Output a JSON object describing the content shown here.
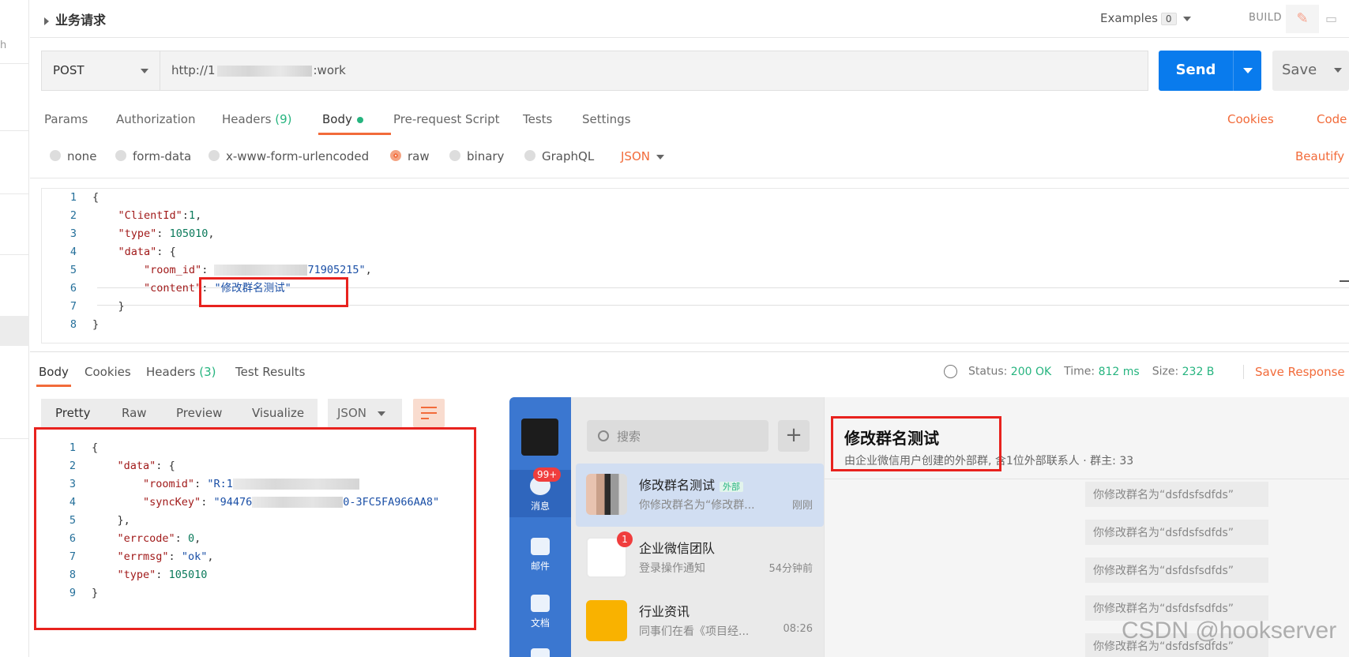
{
  "header": {
    "title": "业务请求",
    "examples_label": "Examples",
    "examples_count": "0",
    "build_label": "BUILD"
  },
  "request": {
    "method": "POST",
    "url_prefix": "http://1",
    "url_suffix": ":work",
    "send_label": "Send",
    "save_label": "Save"
  },
  "request_tabs": {
    "params": "Params",
    "authorization": "Authorization",
    "headers": "Headers",
    "headers_count": "(9)",
    "body": "Body",
    "pre_request": "Pre-request Script",
    "tests": "Tests",
    "settings": "Settings",
    "cookies": "Cookies",
    "code": "Code"
  },
  "body_types": {
    "none": "none",
    "form_data": "form-data",
    "urlencoded": "x-www-form-urlencoded",
    "raw": "raw",
    "binary": "binary",
    "graphql": "GraphQL",
    "json": "JSON",
    "beautify": "Beautify"
  },
  "request_body": {
    "line_numbers": [
      "1",
      "2",
      "3",
      "4",
      "5",
      "6",
      "7",
      "8"
    ],
    "l1": "{",
    "l2_key": "\"ClientId\"",
    "l2_val": "1",
    "l3_key": "\"type\"",
    "l3_val": "105010",
    "l4_key": "\"data\"",
    "l4_open": "{",
    "l5_key": "\"room_id\"",
    "l5_val_tail": "71905215\"",
    "l6_key": "\"content\"",
    "l6_val": "\"修改群名测试\"",
    "l7": "}",
    "l8": "}"
  },
  "response_tabs": {
    "body": "Body",
    "cookies": "Cookies",
    "headers": "Headers",
    "headers_count": "(3)",
    "test_results": "Test Results",
    "status_label": "Status:",
    "status_value": "200 OK",
    "time_label": "Time:",
    "time_value": "812 ms",
    "size_label": "Size:",
    "size_value": "232 B",
    "save_response": "Save Response"
  },
  "view_modes": {
    "pretty": "Pretty",
    "raw": "Raw",
    "preview": "Preview",
    "visualize": "Visualize",
    "format": "JSON"
  },
  "response_body": {
    "line_numbers": [
      "1",
      "2",
      "3",
      "4",
      "5",
      "6",
      "7",
      "8",
      "9"
    ],
    "l1": "{",
    "l2_key": "\"data\"",
    "l2_open": "{",
    "l3_key": "\"roomid\"",
    "l3_val_head": "\"R:1",
    "l4_key": "\"syncKey\"",
    "l4_val_head": "\"94476",
    "l4_val_tail": "0-3FC5FA966AA8\"",
    "l5": "},",
    "l6_key": "\"errcode\"",
    "l6_val": "0",
    "l7_key": "\"errmsg\"",
    "l7_val": "\"ok\"",
    "l8_key": "\"type\"",
    "l8_val": "105010",
    "l9": "}"
  },
  "wecom": {
    "nav": {
      "messages_label": "消息",
      "messages_badge": "99+",
      "mail_label": "邮件",
      "docs_label": "文档"
    },
    "search_placeholder": "搜索",
    "plus": "+",
    "conversations": [
      {
        "name": "修改群名测试",
        "tag": "外部",
        "preview": "你修改群名为“修改群...",
        "time": "刚刚"
      },
      {
        "name": "企业微信团队",
        "badge": "1",
        "preview": "登录操作通知",
        "time": "54分钟前"
      },
      {
        "name": "行业资讯",
        "preview": "同事们在看《项目经...",
        "time": "08:26"
      }
    ],
    "chat": {
      "title": "修改群名测试",
      "subtitle": "由企业微信用户创建的外部群, 含1位外部联系人 · 群主: 33",
      "system_messages": [
        "你修改群名为“dsfdsfsdfds”",
        "你修改群名为“dsfdsfsdfds”",
        "你修改群名为“dsfdsfsdfds”",
        "你修改群名为“dsfdsfsdfds”",
        "你修改群名为“dsfdsfsdfds”"
      ]
    }
  },
  "watermark": "CSDN @hookserver",
  "colors": {
    "accent": "#f26b3a",
    "send": "#097bed",
    "green": "#26b47f",
    "highlight": "#e8221e",
    "wecom_nav": "#3b77d0"
  }
}
